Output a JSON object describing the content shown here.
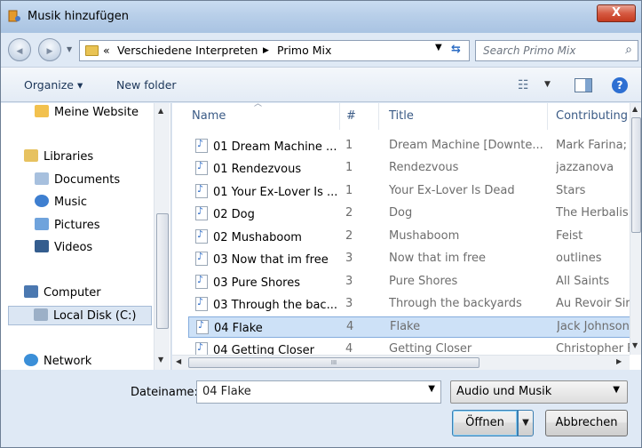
{
  "window": {
    "title": "Musik hinzufügen",
    "close_label": "X"
  },
  "address": {
    "back_label": "◀",
    "forward_label": "▶",
    "crumb_prefix": "«",
    "crumbs": [
      "Verschiedene Interpreten",
      "Primo Mix"
    ],
    "separator": "▶"
  },
  "search": {
    "placeholder": "Search Primo Mix"
  },
  "toolbar": {
    "organize_label": "Organize ▾",
    "new_folder_label": "New folder",
    "help_label": "?"
  },
  "nav": {
    "items": [
      {
        "label": "Meine Website",
        "icon": "website-icon"
      },
      {
        "label": "Libraries",
        "icon": "libraries-icon"
      },
      {
        "label": "Documents",
        "icon": "documents-icon"
      },
      {
        "label": "Music",
        "icon": "music-icon"
      },
      {
        "label": "Pictures",
        "icon": "pictures-icon"
      },
      {
        "label": "Videos",
        "icon": "videos-icon"
      },
      {
        "label": "Computer",
        "icon": "computer-icon"
      },
      {
        "label": "Local Disk (C:)",
        "icon": "disk-icon",
        "selected": true
      },
      {
        "label": "Network",
        "icon": "network-icon"
      }
    ]
  },
  "files": {
    "columns": [
      "Name",
      "#",
      "Title",
      "Contributing"
    ],
    "rows": [
      {
        "name": "01 Dream Machine ...",
        "num": "1",
        "title": "Dream Machine [Downte...",
        "artist": "Mark Farina;"
      },
      {
        "name": "01 Rendezvous",
        "num": "1",
        "title": "Rendezvous",
        "artist": "jazzanova"
      },
      {
        "name": "01 Your Ex-Lover Is ...",
        "num": "1",
        "title": "Your Ex-Lover Is Dead",
        "artist": "Stars"
      },
      {
        "name": "02 Dog",
        "num": "2",
        "title": "Dog",
        "artist": "The Herbalis"
      },
      {
        "name": "02 Mushaboom",
        "num": "2",
        "title": "Mushaboom",
        "artist": "Feist"
      },
      {
        "name": "03 Now that im free",
        "num": "3",
        "title": "Now that im free",
        "artist": "outlines"
      },
      {
        "name": "03 Pure Shores",
        "num": "3",
        "title": "Pure Shores",
        "artist": "All Saints"
      },
      {
        "name": "03 Through the bac...",
        "num": "3",
        "title": "Through the backyards",
        "artist": "Au Revoir Sir"
      },
      {
        "name": "04 Flake",
        "num": "4",
        "title": "Flake",
        "artist": "Jack Johnson",
        "selected": true
      },
      {
        "name": "04 Getting Closer",
        "num": "4",
        "title": "Getting Closer",
        "artist": "Christopher F"
      }
    ],
    "hscroll_grip": "III"
  },
  "footer": {
    "filename_label": "Dateiname:",
    "filename_value": "04 Flake",
    "filetype_value": "Audio und Musik",
    "open_label": "Öffnen",
    "cancel_label": "Abbrechen"
  },
  "colors": {
    "accent": "#2d6fd2",
    "selection": "#cde1f7",
    "header_text": "#3b5b86"
  }
}
